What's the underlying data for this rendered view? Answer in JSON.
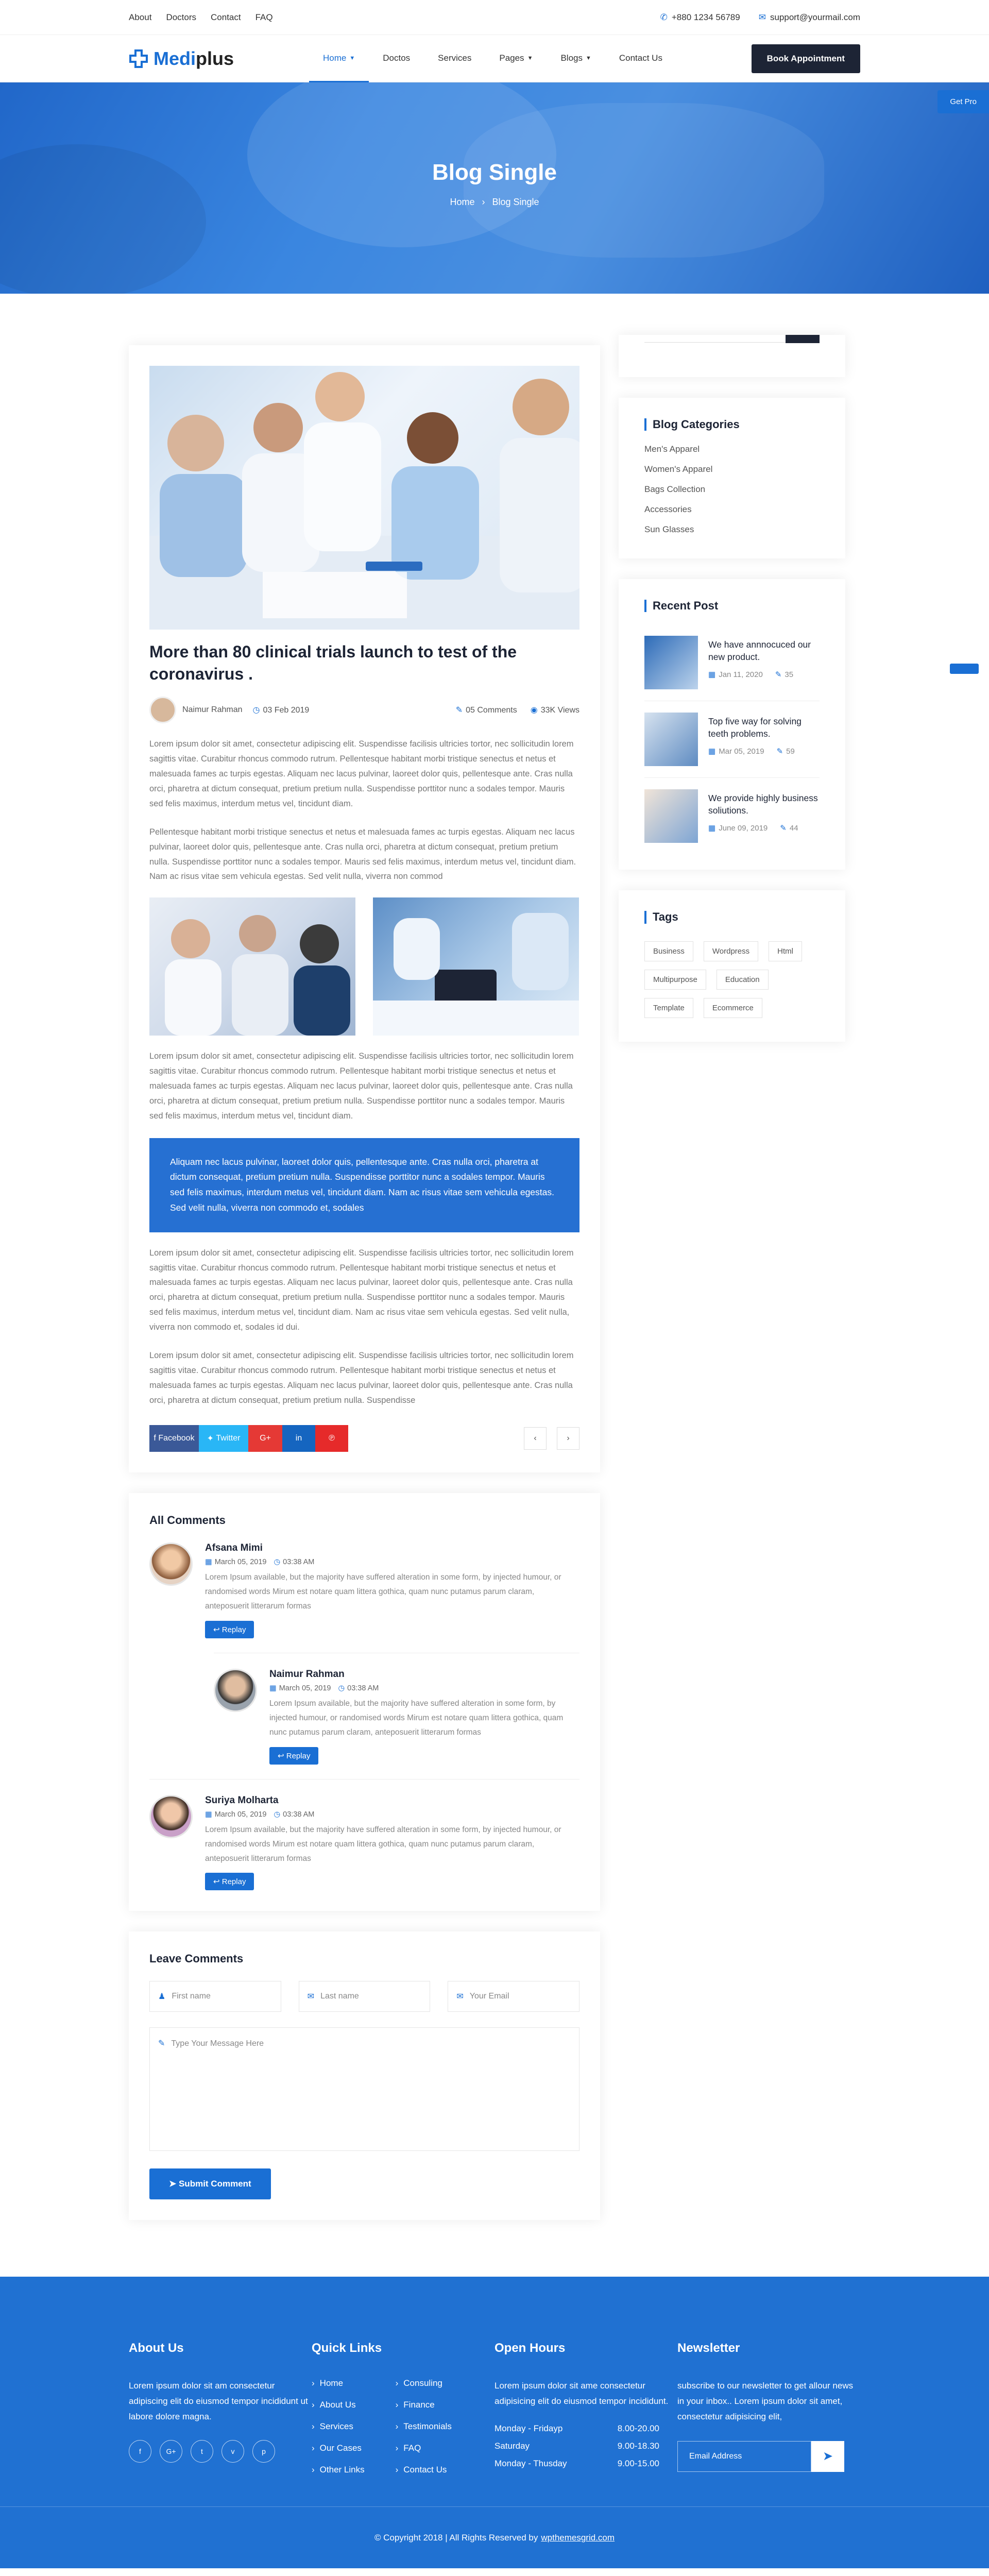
{
  "topbar": {
    "links": [
      "About",
      "Doctors",
      "Contact",
      "FAQ"
    ],
    "phone": "+880 1234 56789",
    "email": "support@yourmail.com"
  },
  "header": {
    "logo_left": "Medi",
    "logo_right": "plus",
    "nav": [
      "Home",
      "Doctos",
      "Services",
      "Pages",
      "Blogs",
      "Contact Us"
    ],
    "book_button": "Book Appointment"
  },
  "banner": {
    "title": "Blog Single",
    "crumb_home": "Home",
    "crumb_sep": "›",
    "crumb_current": "Blog Single",
    "get_pro": "Get Pro"
  },
  "article": {
    "title": "More than 80 clinical trials launch to test of the coronavirus .",
    "author": "Naimur Rahman",
    "date": "03 Feb 2019",
    "comments": "05 Comments",
    "views": "33K Views",
    "para1": "Lorem ipsum dolor sit amet, consectetur adipiscing elit. Suspendisse facilisis ultricies tortor, nec sollicitudin lorem sagittis vitae. Curabitur rhoncus commodo rutrum. Pellentesque habitant morbi tristique senectus et netus et malesuada fames ac turpis egestas. Aliquam nec lacus pulvinar, laoreet dolor quis, pellentesque ante. Cras nulla orci, pharetra at dictum consequat, pretium pretium nulla. Suspendisse porttitor nunc a sodales tempor. Mauris sed felis maximus, interdum metus vel, tincidunt diam.",
    "para2": "Pellentesque habitant morbi tristique senectus et netus et malesuada fames ac turpis egestas. Aliquam nec lacus pulvinar, laoreet dolor quis, pellentesque ante. Cras nulla orci, pharetra at dictum consequat, pretium pretium nulla. Suspendisse porttitor nunc a sodales tempor. Mauris sed felis maximus, interdum metus vel, tincidunt diam. Nam ac risus vitae sem vehicula egestas. Sed velit nulla, viverra non commod",
    "para3": "Lorem ipsum dolor sit amet, consectetur adipiscing elit. Suspendisse facilisis ultricies tortor, nec sollicitudin lorem sagittis vitae. Curabitur rhoncus commodo rutrum. Pellentesque habitant morbi tristique senectus et netus et malesuada fames ac turpis egestas. Aliquam nec lacus pulvinar, laoreet dolor quis, pellentesque ante. Cras nulla orci, pharetra at dictum consequat, pretium pretium nulla. Suspendisse porttitor nunc a sodales tempor. Mauris sed felis maximus, interdum metus vel, tincidunt diam.",
    "quote": "Aliquam nec lacus pulvinar, laoreet dolor quis, pellentesque ante. Cras nulla orci, pharetra at dictum consequat, pretium pretium nulla. Suspendisse porttitor nunc a sodales tempor. Mauris sed felis maximus, interdum metus vel, tincidunt diam. Nam ac risus vitae sem vehicula egestas. Sed velit nulla, viverra non commodo et, sodales",
    "para4": "Lorem ipsum dolor sit amet, consectetur adipiscing elit. Suspendisse facilisis ultricies tortor, nec sollicitudin lorem sagittis vitae. Curabitur rhoncus commodo rutrum. Pellentesque habitant morbi tristique senectus et netus et malesuada fames ac turpis egestas. Aliquam nec lacus pulvinar, laoreet dolor quis, pellentesque ante. Cras nulla orci, pharetra at dictum consequat, pretium pretium nulla. Suspendisse porttitor nunc a sodales tempor. Mauris sed felis maximus, interdum metus vel, tincidunt diam. Nam ac risus vitae sem vehicula egestas. Sed velit nulla, viverra non commodo et, sodales id dui.",
    "para5": "Lorem ipsum dolor sit amet, consectetur adipiscing elit. Suspendisse facilisis ultricies tortor, nec sollicitudin lorem sagittis vitae. Curabitur rhoncus commodo rutrum. Pellentesque habitant morbi tristique senectus et netus et malesuada fames ac turpis egestas. Aliquam nec lacus pulvinar, laoreet dolor quis, pellentesque ante. Cras nulla orci, pharetra at dictum consequat, pretium pretium nulla. Suspendisse",
    "share": {
      "facebook": "Facebook",
      "twitter": "Twitter",
      "google": "G+",
      "linkedin": "in",
      "pinterest": "℗"
    },
    "pager_prev": "‹",
    "pager_next": "›"
  },
  "comments": {
    "heading": "All Comments",
    "reply_label": "Replay",
    "items": [
      {
        "name": "Afsana Mimi",
        "date": "March 05, 2019",
        "time": "03:38 AM",
        "text": "Lorem Ipsum available, but the majority have suffered alteration in some form, by injected humour, or randomised words Mirum est notare quam littera gothica, quam nunc putamus parum claram, anteposuerit litterarum formas"
      },
      {
        "name": "Naimur Rahman",
        "date": "March 05, 2019",
        "time": "03:38 AM",
        "text": "Lorem Ipsum available, but the majority have suffered alteration in some form, by injected humour, or randomised words Mirum est notare quam littera gothica, quam nunc putamus parum claram, anteposuerit litterarum formas"
      },
      {
        "name": "Suriya Molharta",
        "date": "March 05, 2019",
        "time": "03:38 AM",
        "text": "Lorem Ipsum available, but the majority have suffered alteration in some form, by injected humour, or randomised words Mirum est notare quam littera gothica, quam nunc putamus parum claram, anteposuerit litterarum formas"
      }
    ]
  },
  "leave": {
    "heading": "Leave Comments",
    "first_name": "First name",
    "last_name": "Last name",
    "email": "Your Email",
    "message": "Type Your Message Here",
    "submit": "Submit Comment"
  },
  "sidebar": {
    "categories_title": "Blog Categories",
    "categories": [
      "Men's Apparel",
      "Women's Apparel",
      "Bags Collection",
      "Accessories",
      "Sun Glasses"
    ],
    "recent_title": "Recent Post",
    "recent": [
      {
        "title": "We have annnocuced our new product.",
        "date": "Jan 11, 2020",
        "comments": "35"
      },
      {
        "title": "Top five way for solving teeth problems.",
        "date": "Mar 05, 2019",
        "comments": "59"
      },
      {
        "title": "We provide highly business soliutions.",
        "date": "June 09, 2019",
        "comments": "44"
      }
    ],
    "tags_title": "Tags",
    "tags": [
      "Business",
      "Wordpress",
      "Html",
      "Multipurpose",
      "Education",
      "Template",
      "Ecommerce"
    ]
  },
  "footer": {
    "about_title": "About Us",
    "about_text": "Lorem ipsum dolor sit am consectetur adipiscing elit do eiusmod tempor incididunt ut labore dolore magna.",
    "socials": [
      "f",
      "G+",
      "t",
      "v",
      "p"
    ],
    "quick_title": "Quick Links",
    "quick_left": [
      "Home",
      "About Us",
      "Services",
      "Our Cases",
      "Other Links"
    ],
    "quick_right": [
      "Consuling",
      "Finance",
      "Testimonials",
      "FAQ",
      "Contact Us"
    ],
    "hours_title": "Open Hours",
    "hours_text": "Lorem ipsum dolor sit ame consectetur adipisicing elit do eiusmod tempor incididunt.",
    "hours": [
      {
        "day": "Monday - Fridayp",
        "time": "8.00-20.00"
      },
      {
        "day": "Saturday",
        "time": "9.00-18.30"
      },
      {
        "day": "Monday - Thusday",
        "time": "9.00-15.00"
      }
    ],
    "news_title": "Newsletter",
    "news_text": "subscribe to our newsletter to get allour news in your inbox.. Lorem ipsum dolor sit amet, consectetur adipisicing elit,",
    "news_placeholder": "Email Address",
    "copyright": "© Copyright 2018 | All Rights Reserved by",
    "copyright_link": "wpthemesgrid.com"
  },
  "colors": {
    "accent": "#1a6fd4",
    "dark": "#1d2435"
  }
}
